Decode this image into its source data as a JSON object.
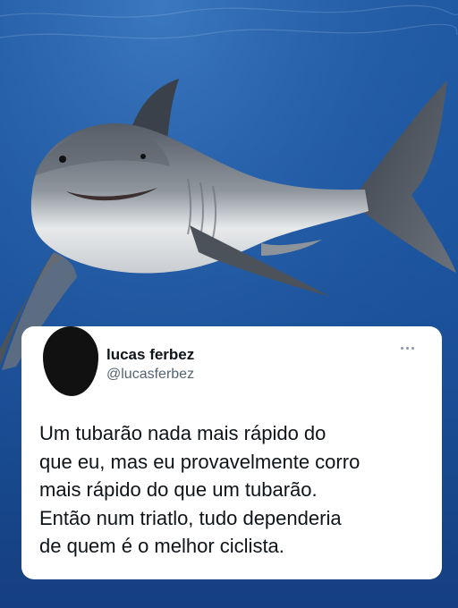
{
  "background": {
    "image_subject": "great white shark swimming underwater",
    "water_color": "#1c559f"
  },
  "tweet": {
    "author_name": "lucas ferbez",
    "author_handle": "@lucasferbez",
    "text": "Um tubarão nada mais rápido do\nque eu, mas eu provavelmente corro\nmais rápido do que um tubarão.\nEntão num triatlo, tudo dependeria\nde quem é o melhor ciclista.",
    "more_icon": "ellipsis-icon"
  }
}
